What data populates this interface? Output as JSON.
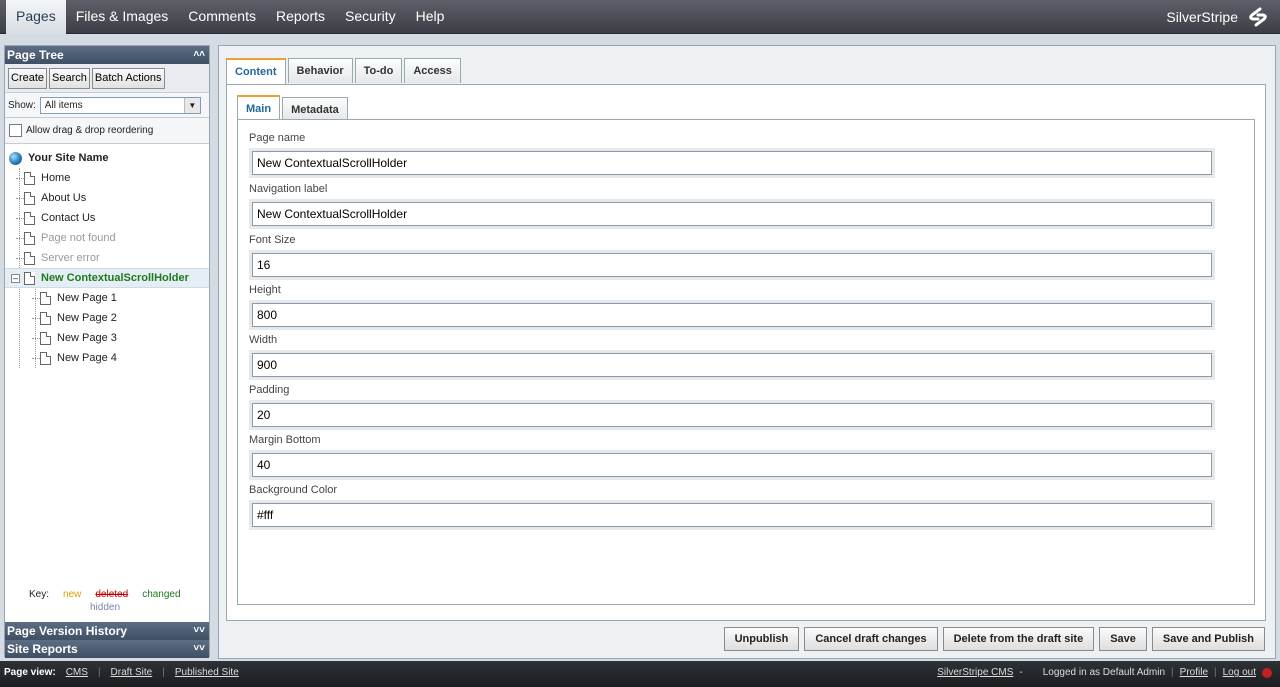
{
  "topmenu": {
    "items": [
      "Pages",
      "Files & Images",
      "Comments",
      "Reports",
      "Security",
      "Help"
    ],
    "brand": "SilverStripe"
  },
  "left": {
    "page_tree_title": "Page Tree",
    "tools": [
      "Create",
      "Search",
      "Batch Actions"
    ],
    "show_label": "Show:",
    "show_value": "All items",
    "drag_label": "Allow drag & drop reordering",
    "site_name": "Your Site Name",
    "pages": [
      "Home",
      "About Us",
      "Contact Us",
      "Page not found",
      "Server error"
    ],
    "selected_page": "New ContextualScrollHolder",
    "children": [
      "New Page 1",
      "New Page 2",
      "New Page 3",
      "New Page 4"
    ],
    "key": {
      "label": "Key:",
      "new": "new",
      "deleted": "deleted",
      "changed": "changed",
      "hidden": "hidden"
    },
    "version_history": "Page Version History",
    "site_reports": "Site Reports"
  },
  "main": {
    "tabs": [
      "Content",
      "Behavior",
      "To-do",
      "Access"
    ],
    "subtabs": [
      "Main",
      "Metadata"
    ],
    "fields": [
      {
        "label": "Page name",
        "value": "New ContextualScrollHolder"
      },
      {
        "label": "Navigation label",
        "value": "New ContextualScrollHolder"
      },
      {
        "label": "Font Size",
        "value": "16"
      },
      {
        "label": "Height",
        "value": "800"
      },
      {
        "label": "Width",
        "value": "900"
      },
      {
        "label": "Padding",
        "value": "20"
      },
      {
        "label": "Margin Bottom",
        "value": "40"
      },
      {
        "label": "Background Color",
        "value": "#fff"
      }
    ],
    "actions": [
      "Unpublish",
      "Cancel draft changes",
      "Delete from the draft site",
      "Save",
      "Save and Publish"
    ]
  },
  "footer": {
    "page_view": "Page view:",
    "links": [
      "CMS",
      "Draft Site",
      "Published Site"
    ],
    "cms_version": "SilverStripe CMS",
    "cms_dash": "-",
    "logged_in": "Logged in as Default Admin",
    "profile": "Profile",
    "logout": "Log out"
  },
  "colors": {
    "accent": "#1f6a9c",
    "changed": "#1d7a1d",
    "new": "#e0a000",
    "deleted": "#c00000"
  }
}
